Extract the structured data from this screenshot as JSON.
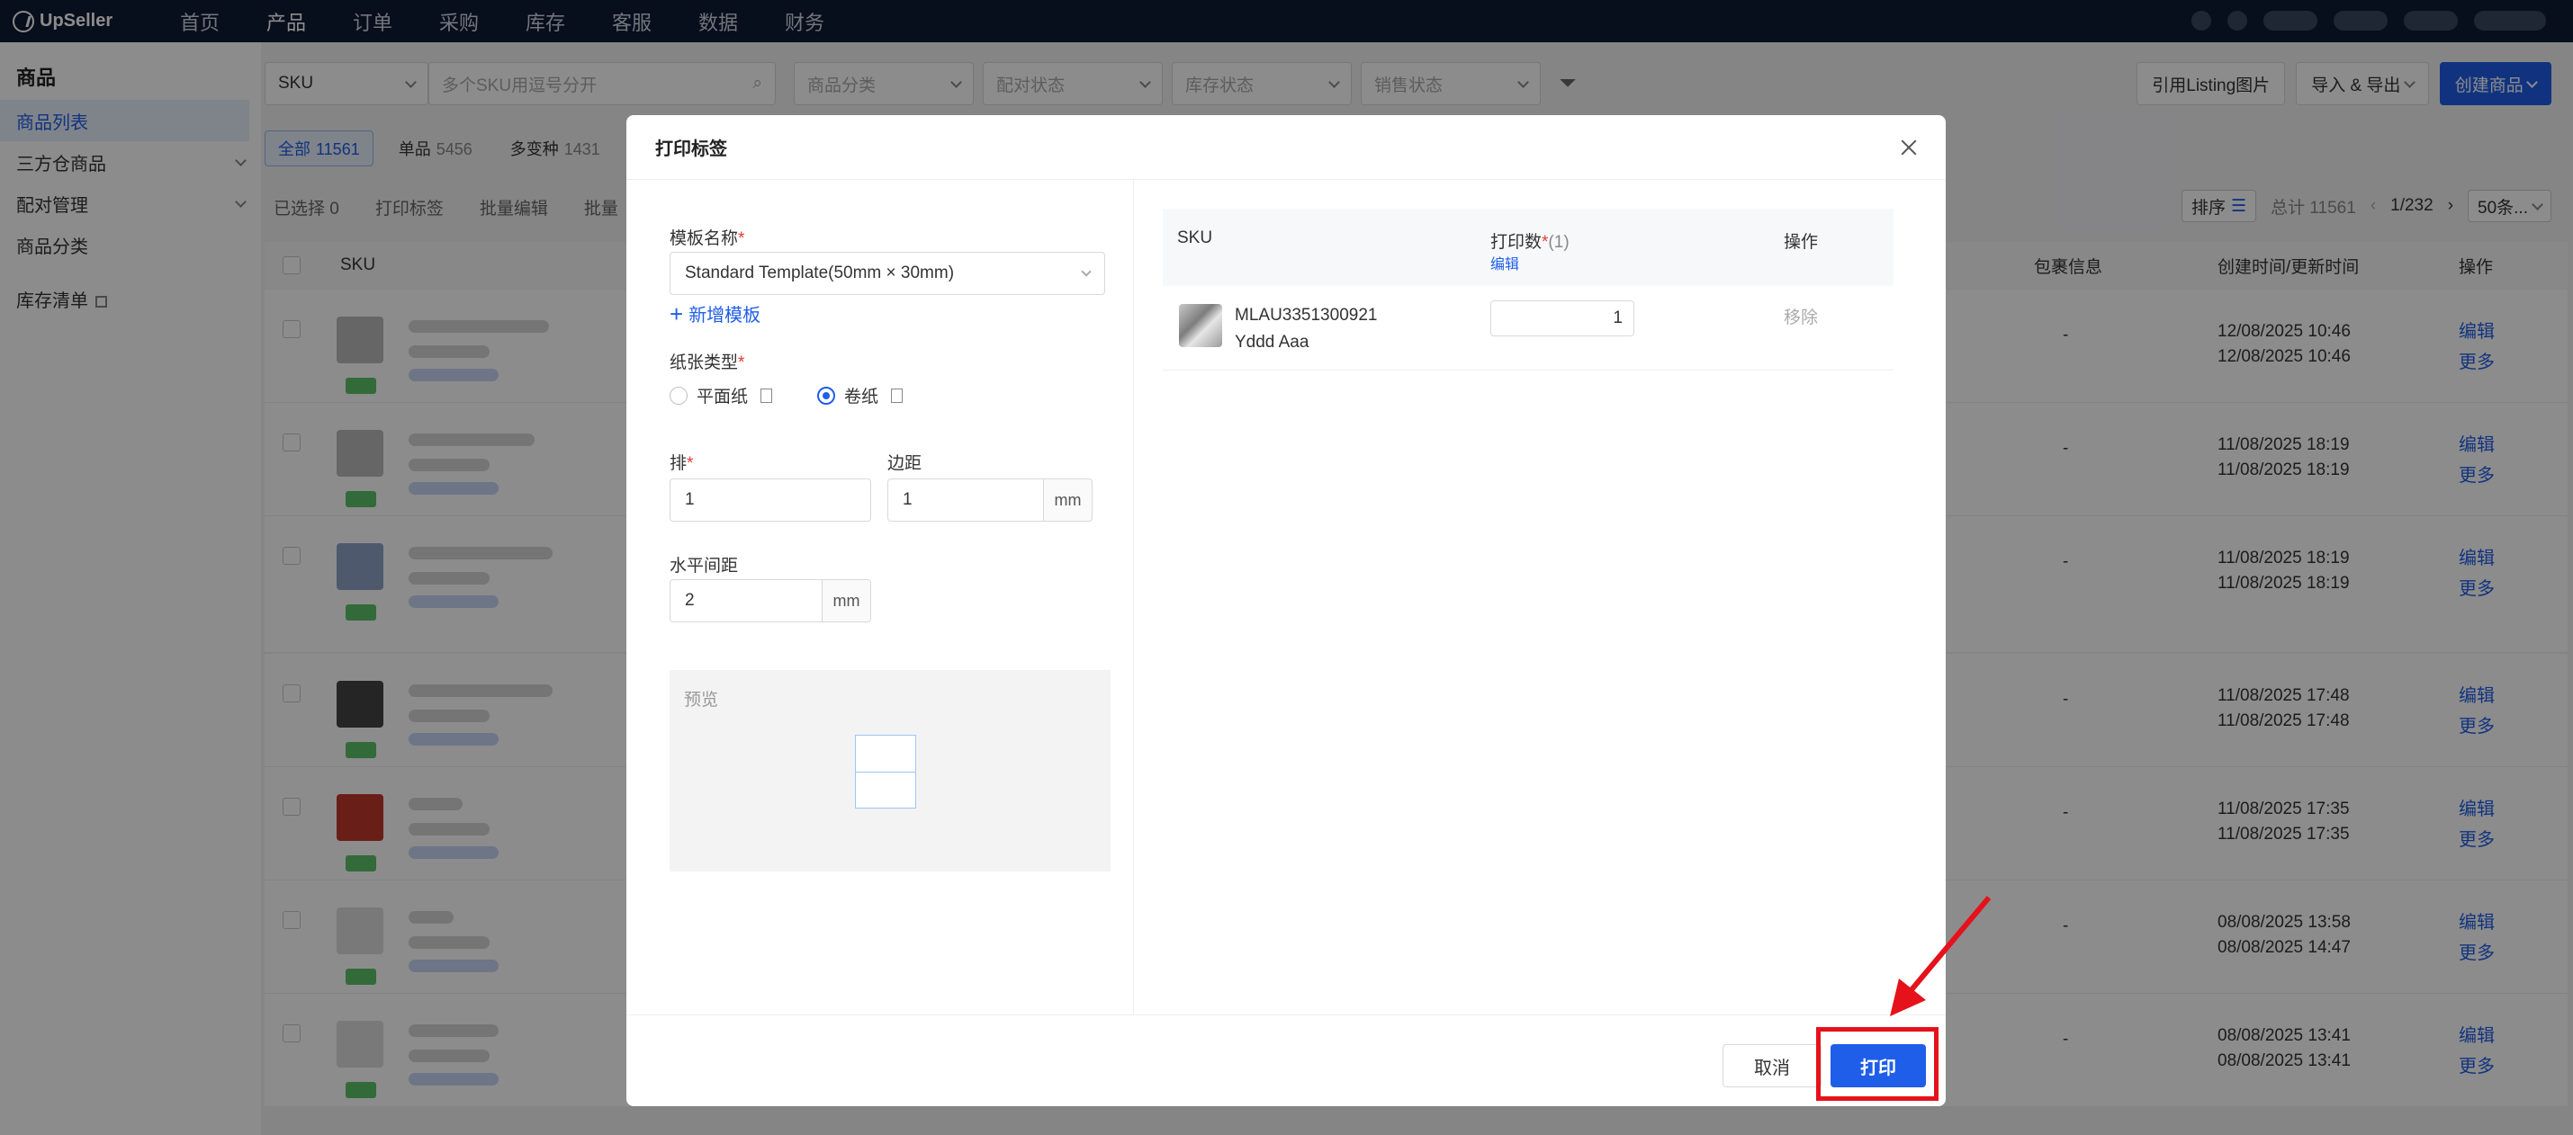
{
  "topnav": {
    "logo": "UpSeller",
    "items": [
      "首页",
      "产品",
      "订单",
      "采购",
      "库存",
      "客服",
      "数据",
      "财务"
    ],
    "active_index": 1
  },
  "sidebar": {
    "title": "商品",
    "items": [
      {
        "label": "商品列表",
        "active": true,
        "expand": false
      },
      {
        "label": "三方仓商品",
        "expand": true
      },
      {
        "label": "配对管理",
        "expand": true
      },
      {
        "label": "商品分类",
        "expand": false
      }
    ],
    "extra": "库存清单"
  },
  "main": {
    "filters": {
      "sku_select": "SKU",
      "sku_placeholder": "多个SKU用逗号分开",
      "category": "商品分类",
      "pair_status": "配对状态",
      "stock_status": "库存状态",
      "sale_status": "销售状态"
    },
    "right_buttons": {
      "listing_image": "引用Listing图片",
      "import_export": "导入 & 导出",
      "create": "创建商品"
    },
    "tabs": [
      {
        "label": "全部",
        "count": "11561"
      },
      {
        "label": "单品",
        "count": "5456"
      },
      {
        "label": "多变种",
        "count": "1431"
      }
    ],
    "toolbar": {
      "selected": "已选择 0",
      "print": "打印标签",
      "batch_edit": "批量编辑",
      "batch": "批量"
    },
    "pager": {
      "sort": "排序",
      "total": "总计 11561",
      "page": "1/232",
      "per_page": "50条..."
    },
    "table_headers": {
      "sku": "SKU",
      "package": "包裹信息",
      "time": "创建时间/更新时间",
      "ops": "操作"
    },
    "rows": [
      {
        "dash": "-",
        "created": "12/08/2025 10:46",
        "updated": "12/08/2025 10:46",
        "edit": "编辑",
        "more": "更多"
      },
      {
        "dash": "-",
        "created": "11/08/2025 18:19",
        "updated": "11/08/2025 18:19",
        "edit": "编辑",
        "more": "更多"
      },
      {
        "dash": "-",
        "created": "11/08/2025 18:19",
        "updated": "11/08/2025 18:19",
        "edit": "编辑",
        "more": "更多"
      },
      {
        "dash": "-",
        "created": "11/08/2025 17:48",
        "updated": "11/08/2025 17:48",
        "edit": "编辑",
        "more": "更多"
      },
      {
        "dash": "-",
        "created": "11/08/2025 17:35",
        "updated": "11/08/2025 17:35",
        "edit": "编辑",
        "more": "更多"
      },
      {
        "dash": "-",
        "created": "08/08/2025 13:58",
        "updated": "08/08/2025 14:47",
        "edit": "编辑",
        "more": "更多"
      },
      {
        "dash": "-",
        "created": "08/08/2025 13:41",
        "updated": "08/08/2025 13:41",
        "edit": "编辑",
        "more": "更多"
      }
    ]
  },
  "modal": {
    "title": "打印标签",
    "template_label": "模板名称",
    "template_value": "Standard Template(50mm × 30mm)",
    "add_template": "新增模板",
    "paper_type_label": "纸张类型",
    "paper_flat": "平面纸",
    "paper_roll": "卷纸",
    "rows_label": "排",
    "rows_value": "1",
    "margin_label": "边距",
    "margin_value": "1",
    "margin_unit": "mm",
    "hgap_label": "水平间距",
    "hgap_value": "2",
    "hgap_unit": "mm",
    "preview_label": "预览",
    "table": {
      "col_sku": "SKU",
      "col_qty": "打印数",
      "col_qty_count": "(1)",
      "col_qty_edit": "编辑",
      "col_ops": "操作",
      "item_sku": "MLAU3351300921",
      "item_name": "Yddd Aaa",
      "item_qty": "1",
      "item_remove": "移除"
    },
    "cancel": "取消",
    "print": "打印"
  },
  "colors": {
    "accent": "#1f5ee8",
    "annotation": "#e5121b",
    "nav_bg": "#0e1a33"
  }
}
